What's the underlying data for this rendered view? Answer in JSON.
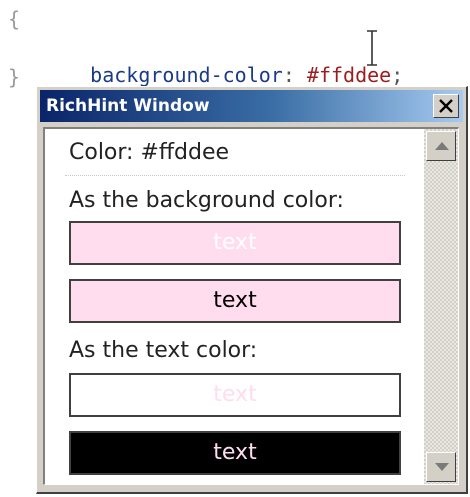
{
  "editor": {
    "open_brace": "{",
    "property": "background-color",
    "colon": ":",
    "value": "#ffddee",
    "semicolon": ";",
    "close_brace": "}"
  },
  "window": {
    "title": "RichHint Window",
    "close_icon": "close-icon"
  },
  "hint": {
    "color_label": "Color: #ffddee",
    "bg_section_label": "As the background color:",
    "text_section_label": "As the text color:",
    "samples": [
      {
        "text": "text",
        "background": "#ffddee",
        "foreground": "#ffffff"
      },
      {
        "text": "text",
        "background": "#ffddee",
        "foreground": "#000000"
      },
      {
        "text": "text",
        "background": "#ffffff",
        "foreground": "#ffddee"
      },
      {
        "text": "text",
        "background": "#000000",
        "foreground": "#ffddee"
      }
    ]
  },
  "icons": {
    "scroll_up": "triangle-up-icon",
    "scroll_down": "triangle-down-icon",
    "cursor": "i-beam-cursor-icon"
  },
  "colors": {
    "sample_color": "#ffddee",
    "title_bar_start": "#0a246a",
    "title_bar_end": "#a6caf0",
    "window_face": "#d4d0c8"
  }
}
